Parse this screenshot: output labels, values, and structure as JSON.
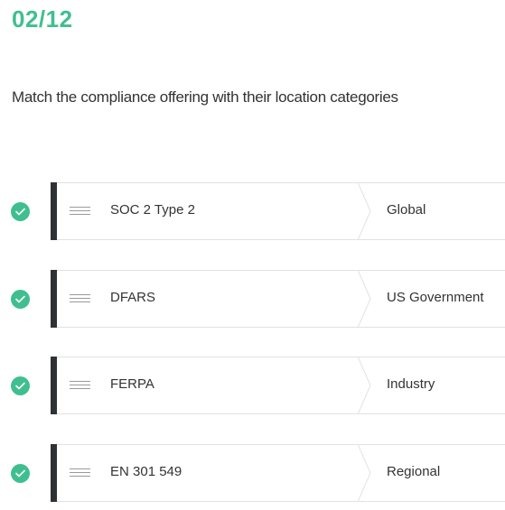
{
  "progress": {
    "counter": "02/12"
  },
  "question": {
    "text": "Match the compliance offering with their location categories"
  },
  "colors": {
    "accent": "#3fbf8f",
    "bar": "#2f3235"
  },
  "matches": [
    {
      "item": "SOC 2 Type 2",
      "category": "Global",
      "status": "correct"
    },
    {
      "item": "DFARS",
      "category": "US Government",
      "status": "correct"
    },
    {
      "item": "FERPA",
      "category": "Industry",
      "status": "correct"
    },
    {
      "item": "EN 301 549",
      "category": "Regional",
      "status": "correct"
    }
  ]
}
